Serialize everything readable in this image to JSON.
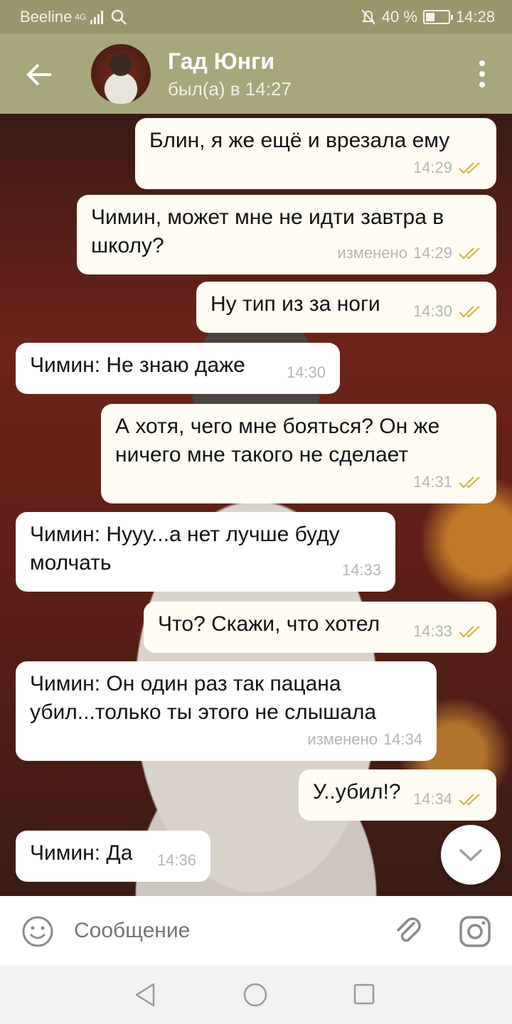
{
  "status_bar": {
    "carrier": "Beeline",
    "network": "4G",
    "battery": "40 %",
    "battery_level": 0.4,
    "time": "14:28"
  },
  "header": {
    "contact_name": "Гад Юнги",
    "contact_status": "был(а) в 14:27"
  },
  "messages": [
    {
      "direction": "out",
      "text": "Блин, я же ещё и врезала ему",
      "time": "14:29",
      "edited": "",
      "read": true
    },
    {
      "direction": "out",
      "text": "Чимин, может мне не идти завтра в школу?",
      "time": "14:29",
      "edited": "изменено",
      "read": true
    },
    {
      "direction": "out",
      "text": "Ну тип из за ноги",
      "time": "14:30",
      "edited": "",
      "read": true
    },
    {
      "direction": "in",
      "text": "Чимин: Не знаю даже",
      "time": "14:30",
      "edited": ""
    },
    {
      "direction": "out",
      "text": "А хотя, чего мне бояться? Он же ничего мне такого не сделает",
      "time": "14:31",
      "edited": "",
      "read": true
    },
    {
      "direction": "in",
      "text": "Чимин: Нууу...а нет лучше буду молчать",
      "time": "14:33",
      "edited": ""
    },
    {
      "direction": "out",
      "text": "Что? Скажи, что хотел",
      "time": "14:33",
      "edited": "",
      "read": true
    },
    {
      "direction": "in",
      "text": "Чимин: Он один раз так пацана убил...только ты этого не слышала",
      "time": "14:34",
      "edited": "изменено"
    },
    {
      "direction": "out",
      "text": "У..убил!?",
      "time": "14:34",
      "edited": "",
      "read": true
    },
    {
      "direction": "in",
      "text": "Чимин: Да",
      "time": "14:36",
      "edited": ""
    }
  ],
  "input": {
    "placeholder": "Сообщение"
  },
  "icons": {
    "back": "arrow-left-icon",
    "menu": "more-vertical-icon",
    "scroll_down": "chevron-down-icon",
    "emoji": "smile-icon",
    "attach": "paperclip-icon",
    "camera": "instagram-camera-icon"
  },
  "colors": {
    "header": "#a8a77a",
    "status_bar": "#9a966a",
    "outgoing_bubble": "#fffdf3",
    "incoming_bubble": "#ffffff",
    "read_check": "#d4b54a"
  }
}
